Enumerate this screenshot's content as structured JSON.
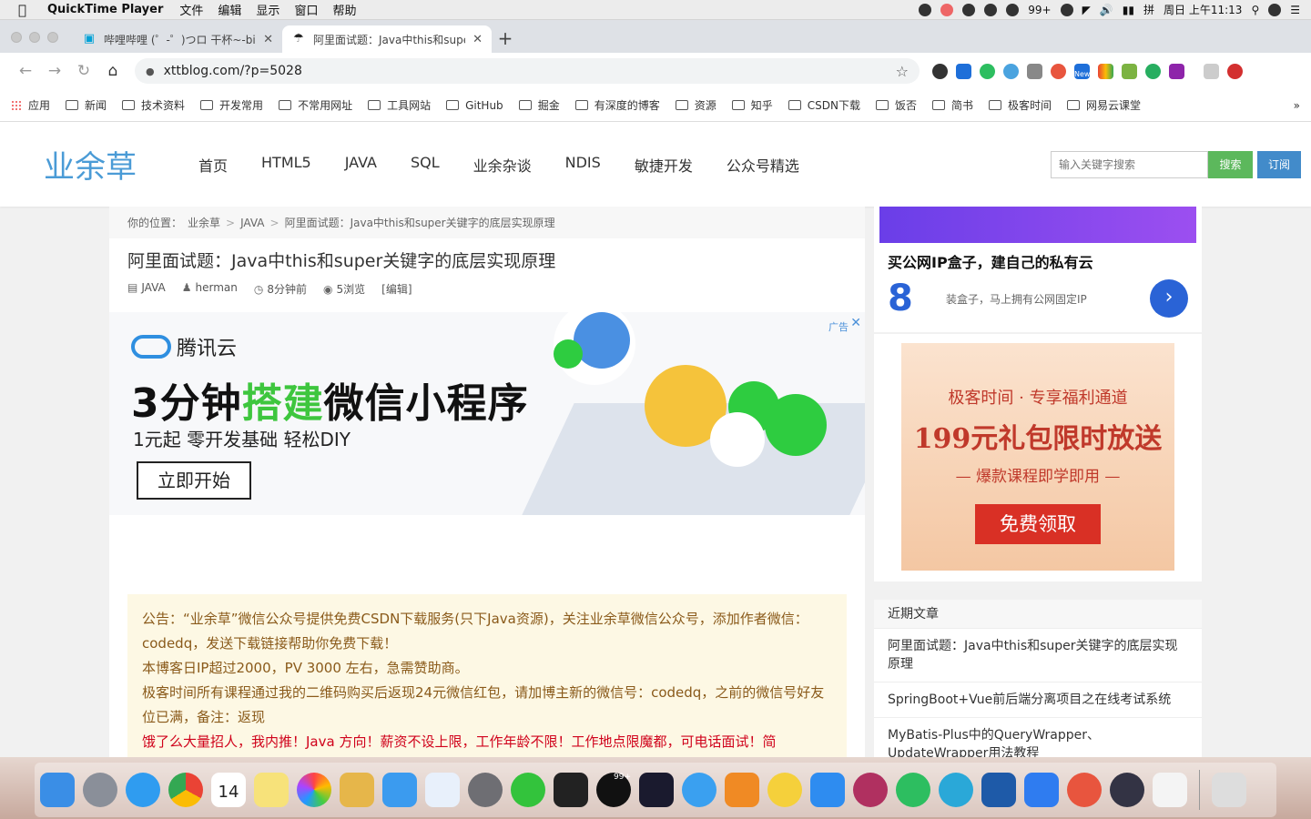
{
  "menubar": {
    "app_name": "QuickTime Player",
    "menus": [
      "文件",
      "编辑",
      "显示",
      "窗口",
      "帮助"
    ],
    "battery_badge": "99+",
    "datetime": "周日 上午11:13"
  },
  "tabs": [
    {
      "title": "哔哩哔哩 (゜-゜)つロ 干杯~-bili",
      "active": false
    },
    {
      "title": "阿里面试题：Java中this和supe",
      "active": true
    }
  ],
  "toolbar": {
    "url": "xttblog.com/?p=5028",
    "extension_badge": "New"
  },
  "bookmarks": [
    "应用",
    "新闻",
    "技术资料",
    "开发常用",
    "不常用网址",
    "工具网站",
    "GitHub",
    "掘金",
    "有深度的博客",
    "资源",
    "知乎",
    "CSDN下载",
    "饭否",
    "简书",
    "极客时间",
    "网易云课堂"
  ],
  "site": {
    "logo": "业余草",
    "nav": [
      "首页",
      "HTML5",
      "JAVA",
      "SQL",
      "业余杂谈",
      "NDIS",
      "敏捷开发",
      "公众号精选"
    ],
    "search_placeholder": "输入关键字搜索",
    "search_button": "搜索",
    "subscribe_button": "订阅"
  },
  "article": {
    "breadcrumb": [
      "你的位置：",
      "业余草",
      "JAVA",
      "阿里面试题：Java中this和super关键字的底层实现原理"
    ],
    "title": "阿里面试题：Java中this和super关键字的底层实现原理",
    "meta": {
      "category": "JAVA",
      "author": "herman",
      "time": "8分钟前",
      "views": "5浏览",
      "edit": "[编辑]"
    }
  },
  "ad_main": {
    "label": "广告",
    "brand": "腾讯云",
    "headline_a": "3分钟",
    "headline_b": "搭建",
    "headline_c": "微信小程序",
    "sub": "1元起 零开发基础 轻松DIY",
    "cta": "立即开始"
  },
  "notice": {
    "line1": "公告：“业余草”微信公众号提供免费CSDN下载服务(只下Java资源)，关注业余草微信公众号，添加作者微信：codedq，发送下载链接帮助你免费下载！",
    "line2": "本博客日IP超过2000，PV 3000 左右，急需赞助商。",
    "line3": "极客时间所有课程通过我的二维码购买后返现24元微信红包，请加博主新的微信号：codedq，之前的微信号好友位已满，备注：返现",
    "line4": "饿了么大量招人，我内推！Java 方向！薪资不设上限，工作年龄不限！工作地点限魔都，可电话面试！简"
  },
  "side_ad1": {
    "title": "买公网IP盒子，建自己的私有云",
    "mark": "8",
    "desc": "装盒子，马上拥有公网固定IP"
  },
  "side_ad2": {
    "l1": "极客时间 · 专享福利通道",
    "l2": "199元礼包限时放送",
    "l3": "— 爆款课程即学即用 —",
    "btn": "免费领取"
  },
  "recent": {
    "heading": "近期文章",
    "items": [
      "阿里面试题：Java中this和super关键字的底层实现原理",
      "SpringBoot+Vue前后端分离项目之在线考试系统",
      "MyBatis-Plus中的QueryWrapper、UpdateWrapper用法教程"
    ]
  },
  "dock": {
    "calendar_day": "14",
    "qq_badge": "99+"
  }
}
